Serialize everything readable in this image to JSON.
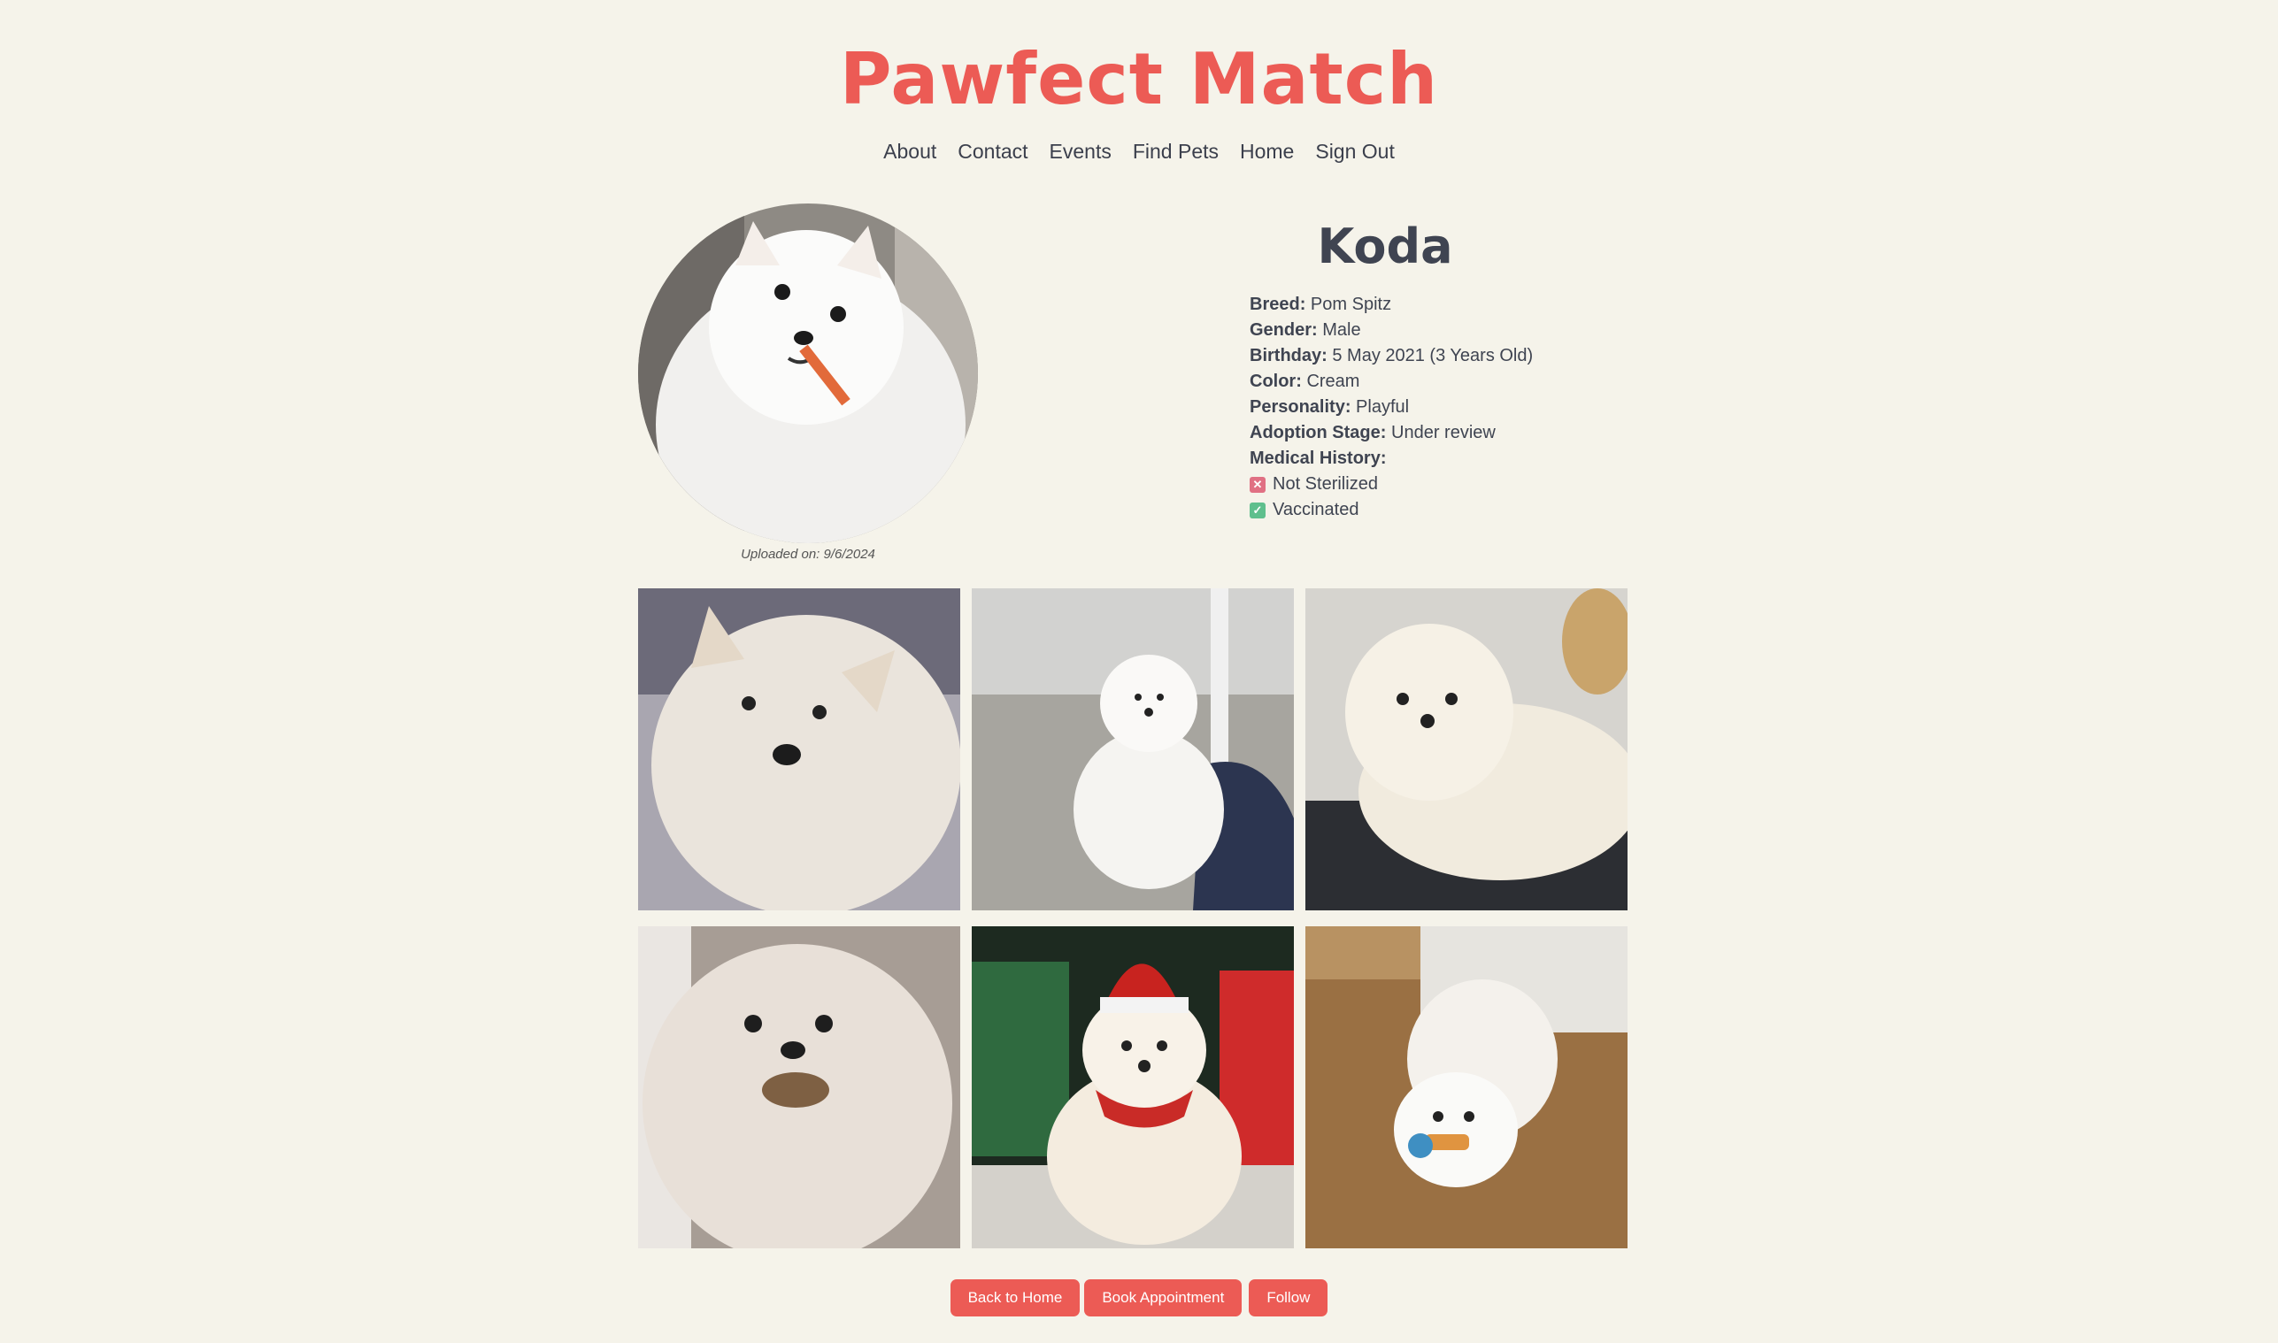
{
  "site": {
    "title": "Pawfect Match"
  },
  "nav": {
    "items": [
      "About",
      "Contact",
      "Events",
      "Find Pets",
      "Home",
      "Sign Out"
    ]
  },
  "pet": {
    "name": "Koda",
    "uploaded": "Uploaded on: 9/6/2024",
    "details": [
      {
        "label": "Breed:",
        "value": "Pom Spitz"
      },
      {
        "label": "Gender:",
        "value": "Male"
      },
      {
        "label": "Birthday:",
        "value": "5 May 2021 (3 Years Old)"
      },
      {
        "label": "Color:",
        "value": "Cream"
      },
      {
        "label": "Personality:",
        "value": "Playful"
      },
      {
        "label": "Adoption Stage:",
        "value": "Under review"
      }
    ],
    "medical": {
      "label": "Medical History:",
      "items": [
        {
          "text": "Not Sterilized",
          "status": "no"
        },
        {
          "text": "Vaccinated",
          "status": "yes"
        }
      ]
    }
  },
  "gallery": {
    "photos": [
      "dog-photo-closeup",
      "dog-photo-on-couch",
      "dog-photo-lying",
      "dog-photo-with-treat",
      "dog-photo-santa-hat",
      "dog-photo-with-toy"
    ]
  },
  "actions": {
    "back_label": "Back to Home",
    "book_label": "Book Appointment",
    "follow_label": "Follow"
  },
  "colors": {
    "accent": "#ec5b55",
    "background": "#f5f3ea",
    "text": "#3f4451"
  }
}
